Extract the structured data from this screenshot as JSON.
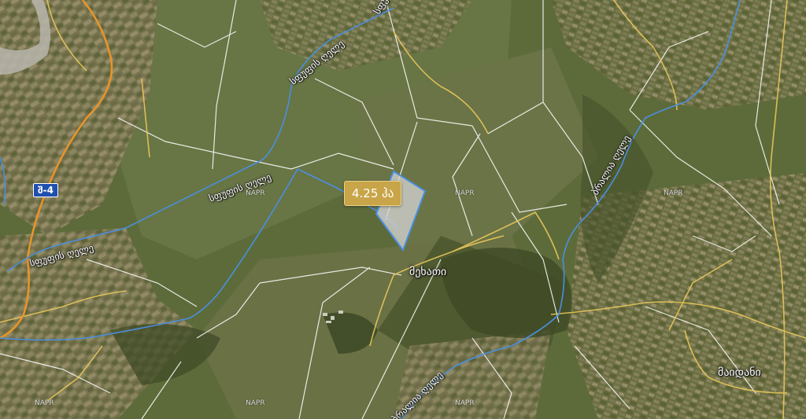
{
  "area_badge": {
    "text": "4.25 ჰა"
  },
  "road_shield": {
    "text": "შ-4"
  },
  "river_labels": [
    "სფუფის ღელე",
    "სფუფის ღელე",
    "სფუფის ღელე",
    "სფუფის ღელე",
    "ბრალია ღელე",
    "ბრალია ღელე"
  ],
  "places": [
    "მეხათი",
    "მაიდანი"
  ],
  "cadastre_labels": [
    "NAPR",
    "NAPR",
    "NAPR",
    "NAPR",
    "NAPR",
    "NAPR"
  ],
  "colors": {
    "parcel_fill": "#d6d6d6",
    "parcel_outline": "#4a90e2",
    "river": "#4a8fe0",
    "main_road": "#e8942a",
    "roads": "#e8c65a",
    "boundaries": "#ffffff",
    "badge": "#c8a548",
    "shield": "#1f4fb0"
  }
}
